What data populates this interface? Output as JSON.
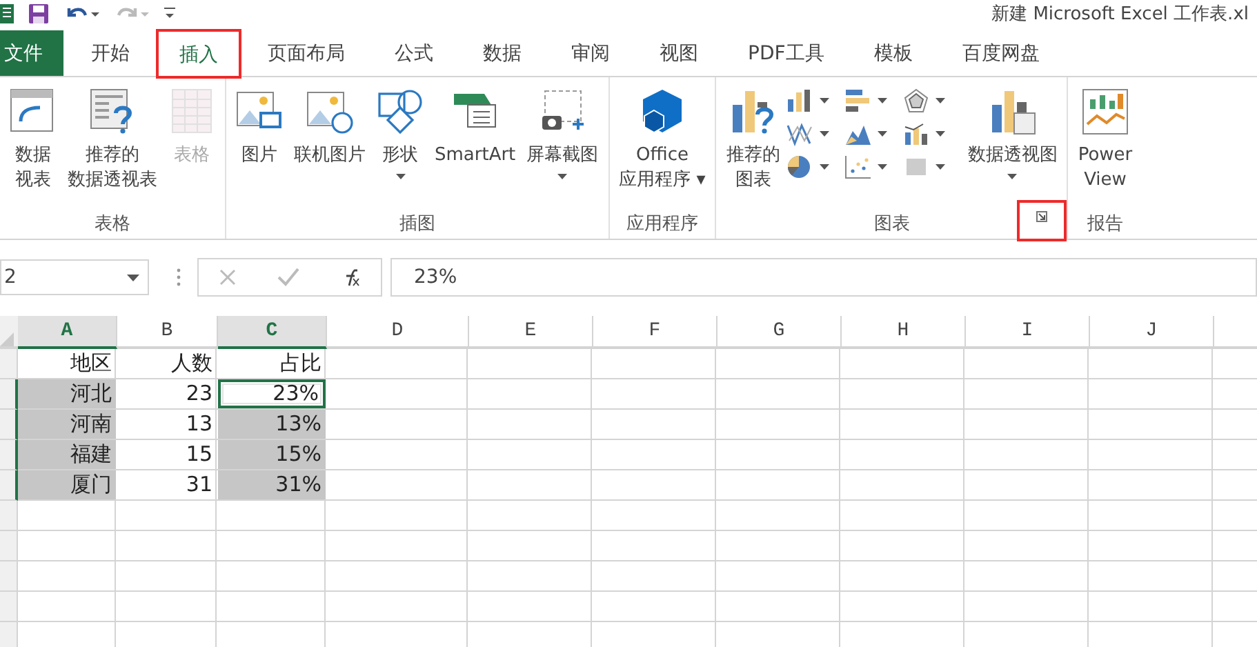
{
  "window": {
    "title": "新建 Microsoft Excel 工作表.xl"
  },
  "tabs": [
    {
      "label": "文件",
      "kind": "file",
      "selected": false,
      "highlighted": false
    },
    {
      "label": "开始",
      "kind": "tab",
      "selected": false,
      "highlighted": false
    },
    {
      "label": "插入",
      "kind": "tab",
      "selected": true,
      "highlighted": true
    },
    {
      "label": "页面布局",
      "kind": "tab",
      "selected": false,
      "highlighted": false
    },
    {
      "label": "公式",
      "kind": "tab",
      "selected": false,
      "highlighted": false
    },
    {
      "label": "数据",
      "kind": "tab",
      "selected": false,
      "highlighted": false
    },
    {
      "label": "审阅",
      "kind": "tab",
      "selected": false,
      "highlighted": false
    },
    {
      "label": "视图",
      "kind": "tab",
      "selected": false,
      "highlighted": false
    },
    {
      "label": "PDF工具",
      "kind": "tab",
      "selected": false,
      "highlighted": false
    },
    {
      "label": "模板",
      "kind": "tab",
      "selected": false,
      "highlighted": false
    },
    {
      "label": "百度网盘",
      "kind": "tab",
      "selected": false,
      "highlighted": false
    }
  ],
  "ribbon": {
    "groups": [
      {
        "label": "表格",
        "items": [
          {
            "kind": "large",
            "lines": [
              "数据",
              "视表"
            ],
            "dropdown": false,
            "disabled": false
          },
          {
            "kind": "large",
            "lines": [
              "推荐的",
              "数据透视表"
            ],
            "dropdown": false,
            "disabled": false
          },
          {
            "kind": "large",
            "lines": [
              "表格"
            ],
            "dropdown": false,
            "disabled": true
          }
        ]
      },
      {
        "label": "插图",
        "items": [
          {
            "kind": "large",
            "lines": [
              "图片"
            ],
            "dropdown": false,
            "disabled": false
          },
          {
            "kind": "large",
            "lines": [
              "联机图片"
            ],
            "dropdown": false,
            "disabled": false
          },
          {
            "kind": "large",
            "lines": [
              "形状"
            ],
            "dropdown": true,
            "disabled": false
          },
          {
            "kind": "large",
            "lines": [
              "SmartArt"
            ],
            "dropdown": false,
            "disabled": false
          },
          {
            "kind": "large",
            "lines": [
              "屏幕截图"
            ],
            "dropdown": true,
            "disabled": false
          }
        ]
      },
      {
        "label": "应用程序",
        "items": [
          {
            "kind": "large",
            "lines": [
              "Office",
              "应用程序 ▾"
            ],
            "dropdown": false,
            "disabled": false
          }
        ]
      },
      {
        "label": "图表",
        "launcher": {
          "highlighted": true
        },
        "items": [
          {
            "kind": "large",
            "lines": [
              "推荐的",
              "图表"
            ],
            "dropdown": false,
            "disabled": false
          },
          {
            "kind": "gallery",
            "buttons": [
              {
                "dropdown": true
              },
              {
                "dropdown": true
              },
              {
                "dropdown": true
              },
              {
                "dropdown": true
              },
              {
                "dropdown": true
              },
              {
                "dropdown": true
              },
              {
                "dropdown": true
              },
              {
                "dropdown": true
              },
              {
                "dropdown": true
              }
            ]
          },
          {
            "kind": "large",
            "lines": [
              "数据透视图"
            ],
            "dropdown": true,
            "disabled": false
          }
        ]
      },
      {
        "label": "报告",
        "items": [
          {
            "kind": "large",
            "lines": [
              "Power",
              "View"
            ],
            "dropdown": false,
            "disabled": false
          }
        ]
      }
    ]
  },
  "formula_bar": {
    "name_box": "2",
    "value": "23%"
  },
  "sheet": {
    "columns": [
      {
        "label": "A",
        "selected": true
      },
      {
        "label": "B",
        "selected": false
      },
      {
        "label": "C",
        "selected": true
      },
      {
        "label": "D",
        "selected": false
      },
      {
        "label": "E",
        "selected": false
      },
      {
        "label": "F",
        "selected": false
      },
      {
        "label": "G",
        "selected": false
      },
      {
        "label": "H",
        "selected": false
      },
      {
        "label": "I",
        "selected": false
      },
      {
        "label": "J",
        "selected": false
      }
    ],
    "rows": [
      {
        "cells": [
          {
            "text": "地区",
            "selected": false,
            "active": false
          },
          {
            "text": "人数",
            "selected": false,
            "active": false
          },
          {
            "text": "占比",
            "selected": false,
            "active": false
          }
        ]
      },
      {
        "cells": [
          {
            "text": "河北",
            "selected": true,
            "active": false
          },
          {
            "text": "23",
            "selected": false,
            "active": false
          },
          {
            "text": "23%",
            "selected": true,
            "active": true
          }
        ]
      },
      {
        "cells": [
          {
            "text": "河南",
            "selected": true,
            "active": false
          },
          {
            "text": "13",
            "selected": false,
            "active": false
          },
          {
            "text": "13%",
            "selected": true,
            "active": false
          }
        ]
      },
      {
        "cells": [
          {
            "text": "福建",
            "selected": true,
            "active": false
          },
          {
            "text": "15",
            "selected": false,
            "active": false
          },
          {
            "text": "15%",
            "selected": true,
            "active": false
          }
        ]
      },
      {
        "cells": [
          {
            "text": "厦门",
            "selected": true,
            "active": false
          },
          {
            "text": "31",
            "selected": false,
            "active": false
          },
          {
            "text": "31%",
            "selected": true,
            "active": false
          }
        ]
      }
    ]
  }
}
